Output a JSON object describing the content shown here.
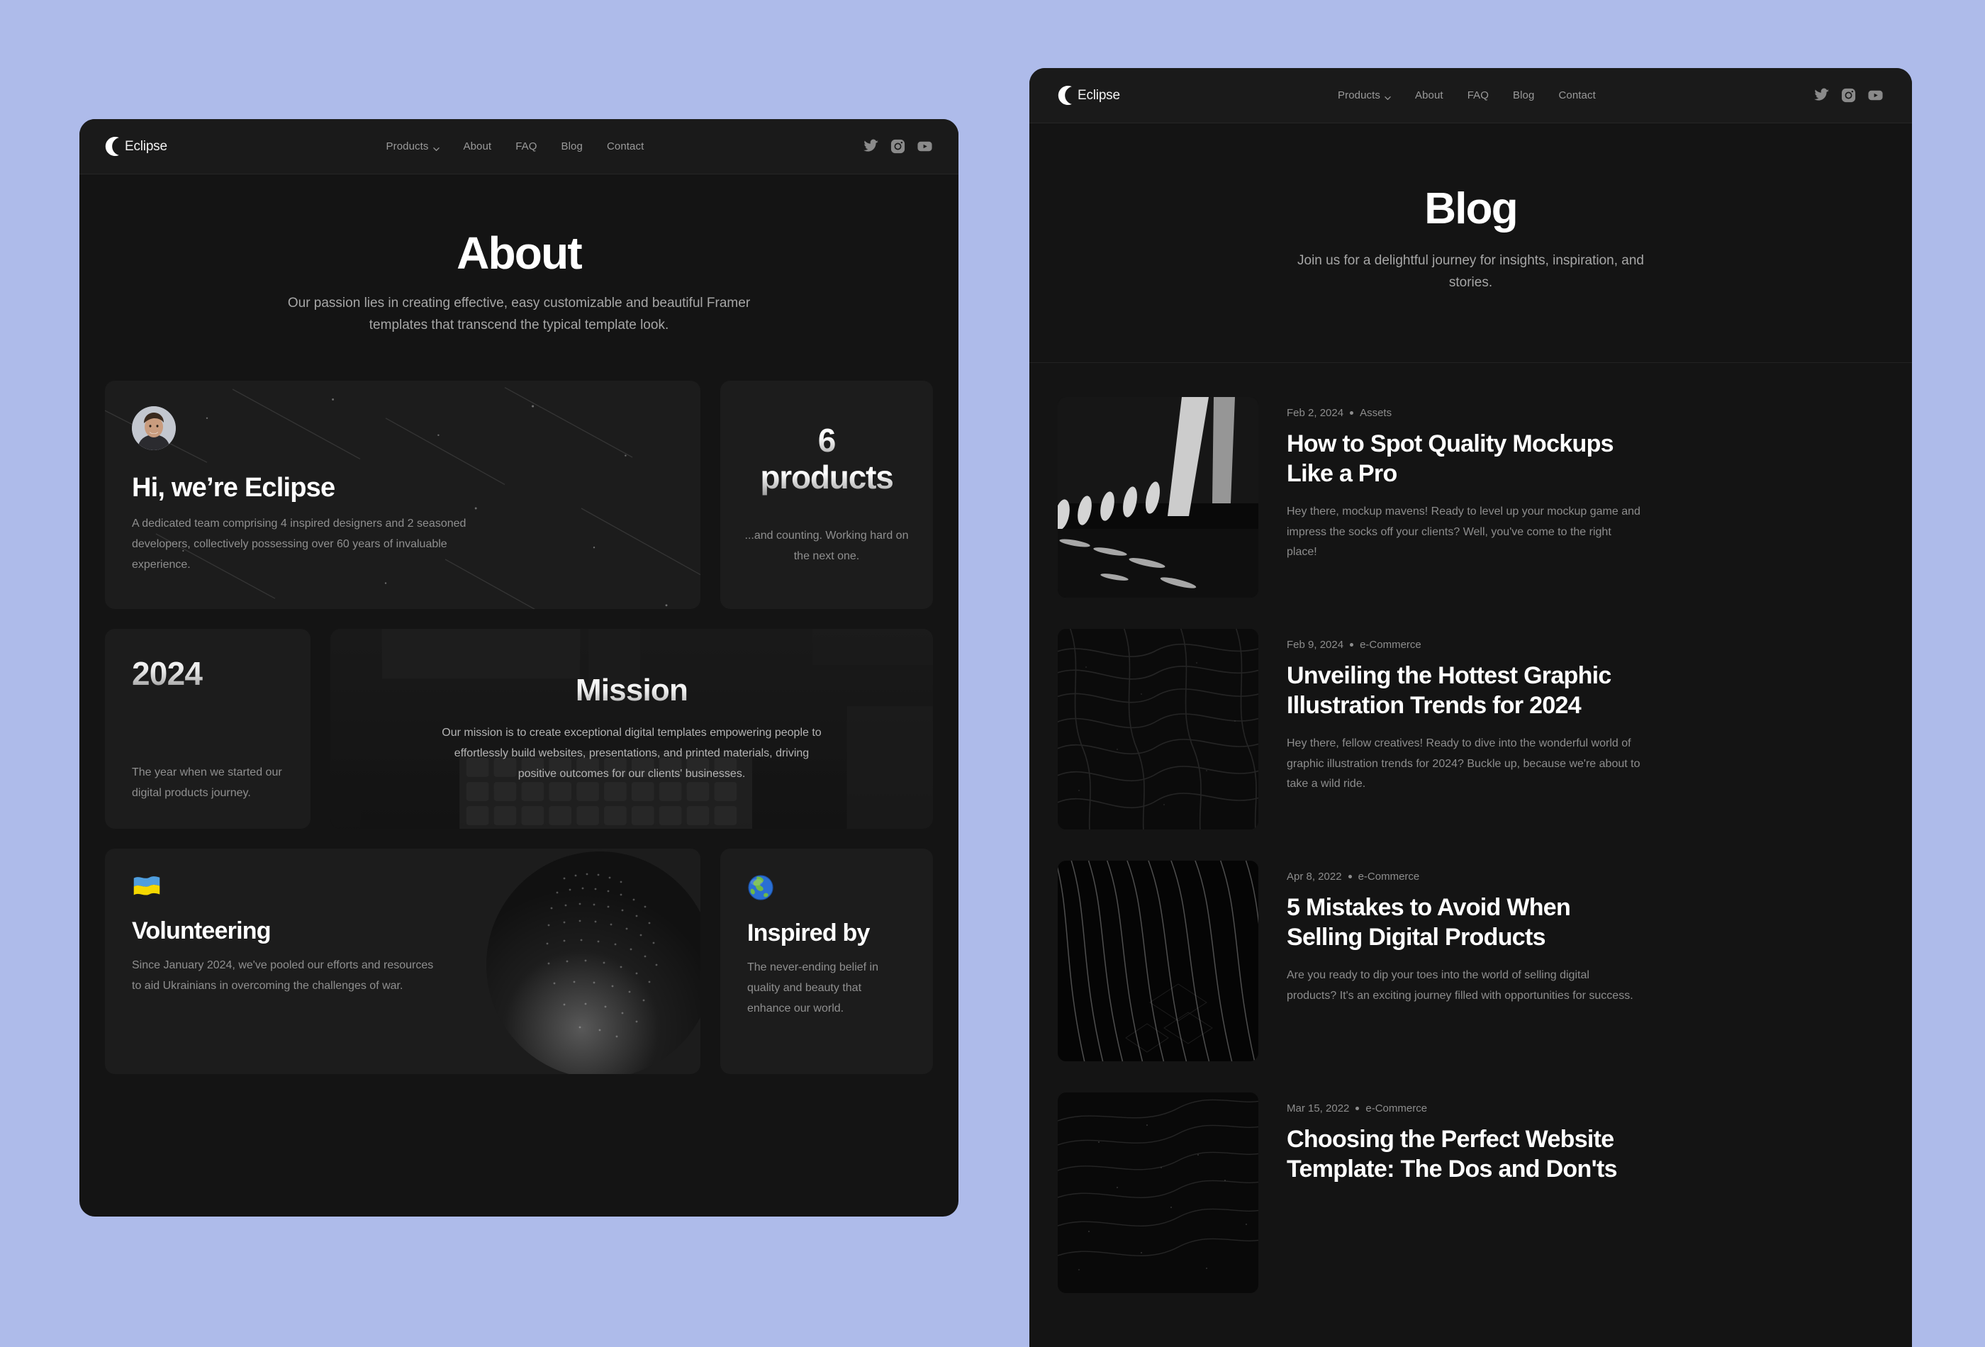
{
  "page": {
    "background_color": "#aebbea",
    "panel_background": "#141414",
    "card_background": "#1c1c1c",
    "accent_text": "#ffffff",
    "muted_text": "#8f8f8f"
  },
  "brand": {
    "name": "Eclipse",
    "logo_icon": "eclipse-crescent-icon"
  },
  "nav": {
    "items": [
      {
        "label": "Products",
        "has_dropdown": true,
        "icon": "chevron-down-icon"
      },
      {
        "label": "About",
        "has_dropdown": false
      },
      {
        "label": "FAQ",
        "has_dropdown": false
      },
      {
        "label": "Blog",
        "has_dropdown": false
      },
      {
        "label": "Contact",
        "has_dropdown": false
      }
    ],
    "socials": [
      {
        "name": "twitter-icon",
        "label": "Twitter"
      },
      {
        "name": "instagram-icon",
        "label": "Instagram"
      },
      {
        "name": "youtube-icon",
        "label": "YouTube"
      }
    ]
  },
  "about_page": {
    "hero": {
      "title": "About",
      "subtitle": "Our passion lies in creating effective, easy customizable and beautiful Framer templates that transcend the typical template look."
    },
    "cards": {
      "team": {
        "avatar_name": "team-avatar",
        "title": "Hi, we’re Eclipse",
        "body": "A dedicated team comprising 4 inspired designers and 2 seasoned developers, collectively possessing over 60 years of invaluable experience."
      },
      "products": {
        "value": "6",
        "unit": "products",
        "body": "...and counting. Working hard on the next one."
      },
      "year": {
        "value": "2024",
        "body": "The year when we started our digital products journey."
      },
      "mission": {
        "title": "Mission",
        "body": "Our mission is to create exceptional digital templates empowering people to effortlessly build websites, presentations, and printed materials, driving positive outcomes for our clients' businesses."
      },
      "volunteering": {
        "emoji": "ukraine-flag-emoji",
        "title": "Volunteering",
        "body": "Since January 2024, we've pooled our efforts and resources to aid Ukrainians in overcoming the challenges of war."
      },
      "inspired": {
        "emoji": "earth-globe-emoji",
        "title": "Inspired by",
        "body": "The never-ending belief in quality and beauty that enhance our world."
      }
    }
  },
  "blog_page": {
    "hero": {
      "title": "Blog",
      "subtitle": "Join us for a delightful journey for insights, inspiration, and stories."
    },
    "posts": [
      {
        "date": "Feb 2, 2024",
        "category": "Assets",
        "title": "How to Spot Quality Mockups Like a Pro",
        "excerpt": "Hey there, mockup mavens! Ready to level up your mockup game and impress the socks off your clients? Well, you've come to the right place!",
        "thumbnail": "architecture-light-tunnel"
      },
      {
        "date": "Feb 9, 2024",
        "category": "e-Commerce",
        "title": "Unveiling the Hottest Graphic Illustration Trends for 2024",
        "excerpt": "Hey there, fellow creatives! Ready to dive into the wonderful world of graphic illustration trends for 2024? Buckle up, because we're about to take a wild ride.",
        "thumbnail": "rocky-terrain-texture"
      },
      {
        "date": "Apr 8, 2022",
        "category": "e-Commerce",
        "title": "5 Mistakes to Avoid When Selling Digital Products",
        "excerpt": "Are you ready to dip your toes into the world of selling digital products? It's an exciting journey filled with opportunities for success.",
        "thumbnail": "curved-ribbed-structure"
      },
      {
        "date": "Mar 15, 2022",
        "category": "e-Commerce",
        "title": "Choosing the Perfect Website Template: The Dos and Don'ts",
        "excerpt": "",
        "thumbnail": "dark-sand-dunes"
      }
    ]
  }
}
